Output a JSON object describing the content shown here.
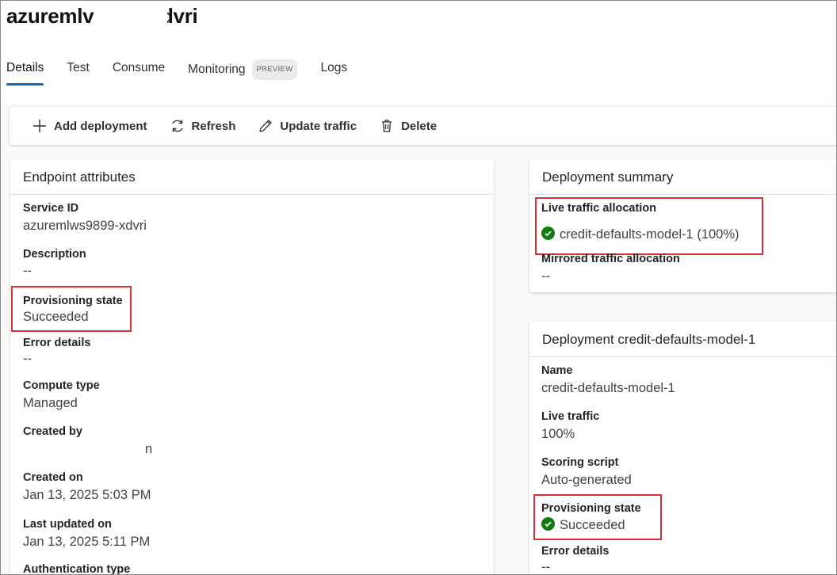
{
  "page": {
    "title": "azuremlv  9899 xdvri"
  },
  "tabs": [
    {
      "label": "Details",
      "active": true
    },
    {
      "label": "Test"
    },
    {
      "label": "Consume"
    },
    {
      "label": "Monitoring",
      "badge": "PREVIEW"
    },
    {
      "label": "Logs"
    }
  ],
  "toolbar": {
    "add_label": "Add deployment",
    "refresh_label": "Refresh",
    "update_label": "Update traffic",
    "delete_label": "Delete"
  },
  "endpoint": {
    "heading": "Endpoint attributes",
    "service_id_label": "Service ID",
    "service_id_value": "azuremlws9899-xdvri",
    "description_label": "Description",
    "description_value": "--",
    "provisioning_label": "Provisioning state",
    "provisioning_value": "Succeeded",
    "error_label": "Error details",
    "error_value": "--",
    "compute_label": "Compute type",
    "compute_value": "Managed",
    "created_by_label": "Created by",
    "created_by_value": "n",
    "created_on_label": "Created on",
    "created_on_value": "Jan 13, 2025 5:03 PM",
    "updated_label": "Last updated on",
    "updated_value": "Jan 13, 2025 5:11 PM",
    "auth_label": "Authentication type"
  },
  "summary": {
    "heading": "Deployment summary",
    "live_label": "Live traffic allocation",
    "live_value": "credit-defaults-model-1 (100%)",
    "mirrored_label": "Mirrored traffic allocation",
    "mirrored_value": "--"
  },
  "deployment": {
    "heading": "Deployment credit-defaults-model-1",
    "name_label": "Name",
    "name_value": "credit-defaults-model-1",
    "traffic_label": "Live traffic",
    "traffic_value": "100%",
    "scoring_label": "Scoring script",
    "scoring_value": "Auto-generated",
    "provisioning_label": "Provisioning state",
    "provisioning_value": "Succeeded",
    "error_label": "Error details",
    "error_value": "--"
  },
  "colors": {
    "accent": "#0f6cbd",
    "success": "#107c10",
    "highlight": "#d13438"
  }
}
